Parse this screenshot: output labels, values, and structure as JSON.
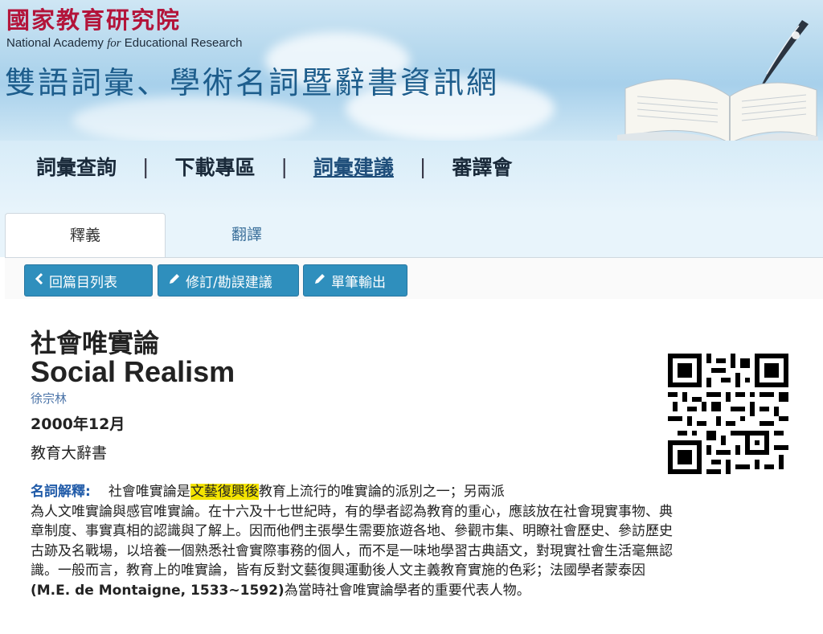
{
  "header": {
    "org_name_zh": "國家教育研究院",
    "org_name_en_prefix": "National Academy ",
    "org_name_en_italic": "for",
    "org_name_en_suffix": " Educational Research",
    "site_title": "雙語詞彙、學術名詞暨辭書資訊網"
  },
  "nav": {
    "items": [
      {
        "label": "詞彙查詢"
      },
      {
        "label": "下載專區"
      },
      {
        "label": "詞彙建議"
      },
      {
        "label": "審譯會"
      }
    ],
    "separator": "|",
    "active_index": 2
  },
  "tabs": [
    {
      "label": "釋義",
      "active": true
    },
    {
      "label": "翻譯",
      "active": false
    }
  ],
  "toolbar": {
    "back_label": "回篇目列表",
    "suggest_label": "修訂/勘誤建議",
    "export_label": "單筆輸出",
    "back_icon": "chevron-left-icon",
    "pencil_icon": "pencil-icon"
  },
  "entry": {
    "term_zh": "社會唯實論",
    "term_en": "Social Realism",
    "author": "徐宗林",
    "date": "2000年12月",
    "source": "教育大辭書",
    "definition_label": "名詞解釋:",
    "definition_pre": "社會唯實論是",
    "definition_highlight": "文藝復興後",
    "definition_line1_rest": "教育上流行的唯實論的派別之一；另兩派",
    "definition_line2": "為人文唯實論與感官唯實論。在十六及十七世紀時，有的學者認為教育的重心，應該放在社會現實事物、典",
    "definition_line3": "章制度、事實真相的認識與了解上。因而他們主張學生需要旅遊各地、參觀市集、明瞭社會歷史、參訪歷史",
    "definition_line4": "古跡及名戰場，以培養一個熟悉社會實際事務的個人，而不是一味地學習古典語文，對現實社會生活毫無認",
    "definition_line5": "識。一般而言，教育上的唯實論，皆有反對文藝復興運動後人文主義教育實施的色彩；法國學者蒙泰因",
    "definition_line6_bold": "(M.E. de Montaigne, 1533~1592)",
    "definition_line6_rest": "為當時社會唯實論學者的重要代表人物。"
  },
  "colors": {
    "org_red": "#b3143a",
    "title_blue": "#1d5d8c",
    "button_blue": "#2f8fbd",
    "highlight_yellow": "#f4e400",
    "label_blue": "#1f5aa8"
  }
}
